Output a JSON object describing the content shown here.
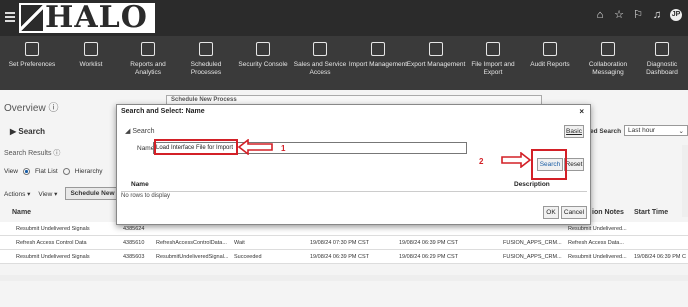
{
  "brand": {
    "logo_text": "HALO"
  },
  "topbar": {
    "icons": [
      "home-icon",
      "star-icon",
      "flag-icon",
      "bell-icon"
    ],
    "avatar_text": "JP"
  },
  "nav": [
    {
      "label": "Set Preferences",
      "icon": "person-gear-icon"
    },
    {
      "label": "Worklist",
      "icon": "clipboard-icon"
    },
    {
      "label": "Reports and Analytics",
      "icon": "chart-icon"
    },
    {
      "label": "Scheduled Processes",
      "icon": "grid-icon"
    },
    {
      "label": "Security Console",
      "icon": "shield-icon"
    },
    {
      "label": "Sales and Service Access",
      "icon": "shield-check-icon"
    },
    {
      "label": "Import Management",
      "icon": "download-icon"
    },
    {
      "label": "Export Management",
      "icon": "upload-icon"
    },
    {
      "label": "File Import and Export",
      "icon": "arrows-icon"
    },
    {
      "label": "Audit Reports",
      "icon": "report-icon"
    },
    {
      "label": "Collaboration Messaging",
      "icon": "swap-icon"
    },
    {
      "label": "Diagnostic Dashboard",
      "icon": "dashboard-icon"
    }
  ],
  "page": {
    "overview": "Overview",
    "search_heading": "Search",
    "results_heading": "Search Results",
    "view_label": "View",
    "flat_list": "Flat List",
    "hierarchy": "Hierarchy",
    "actions": "Actions ▾",
    "view_menu": "View ▾",
    "schedule_btn": "Schedule New P",
    "saved_search_label": "ed Search",
    "saved_search_value": "Last hour"
  },
  "table": {
    "headers": [
      "Name",
      "ion Notes",
      "Start Time"
    ],
    "rows": [
      [
        "Resubmit Undelivered Signals",
        "4385624",
        "",
        "",
        "",
        "",
        "",
        "Resubmit Undelivered...",
        ""
      ],
      [
        "Refresh Access Control Data",
        "4385610",
        "RefreshAccessControlData...",
        "Wait",
        "19/08/24 07:30 PM CST",
        "19/08/24 06:39 PM CST",
        "FUSION_APPS_CRM...",
        "Refresh Access Data...",
        ""
      ],
      [
        "Resubmit Undelivered Signals",
        "4385603",
        "ResubmitUndeliveredSignal...",
        "Succeeded",
        "19/08/24 06:39 PM CST",
        "19/08/24 06:29 PM CST",
        "FUSION_APPS_CRM...",
        "Resubmit Undelivered...",
        "19/08/24 06:39 PM C"
      ]
    ]
  },
  "back_window": {
    "title": "Schedule New Process"
  },
  "dialog": {
    "title": "Search and Select: Name",
    "close": "×",
    "search_label": "Search",
    "basic_btn": "Basic",
    "name_label": "Name",
    "name_value": "Load Interface File for Import",
    "search_btn": "Search",
    "reset_btn": "Reset",
    "col_name": "Name",
    "col_desc": "Description",
    "no_rows": "No rows to display",
    "ok_btn": "OK",
    "cancel_btn": "Cancel"
  },
  "annotations": {
    "step1": "1",
    "step2": "2",
    "color": "#d32027"
  }
}
